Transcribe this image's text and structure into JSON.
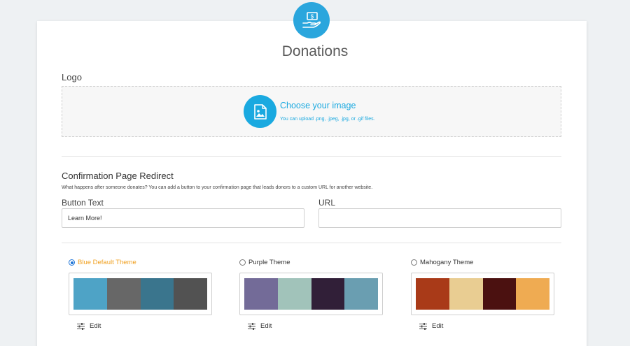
{
  "page": {
    "title": "Donations"
  },
  "logo": {
    "label": "Logo",
    "upload_title": "Choose your image",
    "upload_hint": "You can upload .png, .jpeg, .jpg, or .gif files."
  },
  "redirect": {
    "title": "Confirmation Page Redirect",
    "description": "What happens after someone donates? You can add a button to your confirmation page that leads donors to a custom URL for another website.",
    "button_text_label": "Button Text",
    "button_text_value": "Learn More!",
    "url_label": "URL",
    "url_value": ""
  },
  "themes": [
    {
      "name": "Blue Default Theme",
      "selected": true,
      "colors": [
        "#4ea3c6",
        "#676767",
        "#3a758d",
        "#525252"
      ],
      "edit_label": "Edit"
    },
    {
      "name": "Purple Theme",
      "selected": false,
      "colors": [
        "#736b98",
        "#a1c3ba",
        "#311f38",
        "#6a9eb1"
      ],
      "edit_label": "Edit"
    },
    {
      "name": "Mahogany Theme",
      "selected": false,
      "colors": [
        "#a93a18",
        "#e9cd92",
        "#4b1110",
        "#efab52"
      ],
      "edit_label": "Edit"
    }
  ],
  "colors": {
    "accent": "#1aa9e0",
    "selected_theme_text": "#f0a020",
    "radio_selected": "#1e74d6",
    "background": "#eef1f3"
  },
  "icons": {
    "header": "donation-hand-icon",
    "upload": "image-upload-icon",
    "edit": "sliders-icon"
  }
}
